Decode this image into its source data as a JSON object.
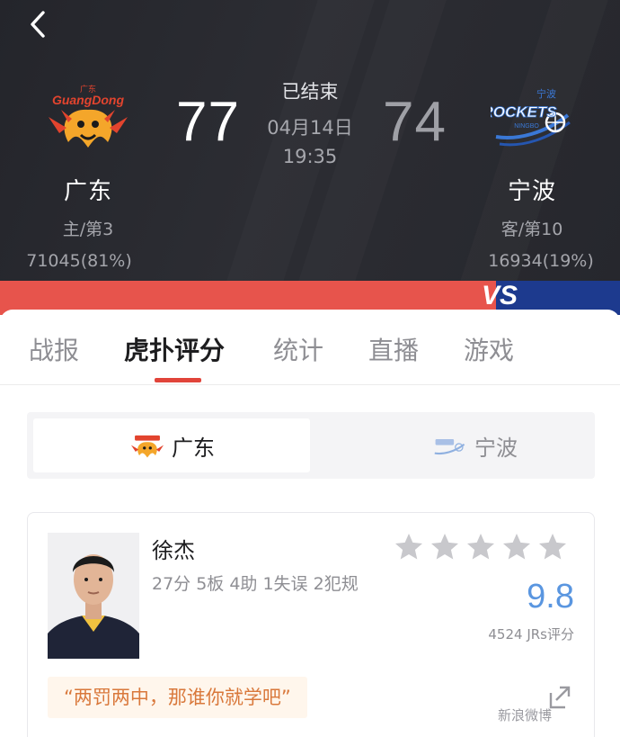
{
  "header": {
    "status": "已结束",
    "date": "04月14日",
    "time": "19:35",
    "home": {
      "name": "广东",
      "score": "77",
      "rank": "主/第3",
      "votes": "71045(81%)",
      "logo_text": "GuangDong",
      "logo_small": "广东"
    },
    "away": {
      "name": "宁波",
      "score": "74",
      "rank": "客/第10",
      "votes": "16934(19%)",
      "logo_text": "ROCKETS",
      "logo_small": "宁波",
      "logo_sub": "NINGBO"
    }
  },
  "vs_label": "VS",
  "tabs": [
    {
      "label": "战报"
    },
    {
      "label": "虎扑评分",
      "active": true
    },
    {
      "label": "统计"
    },
    {
      "label": "直播"
    },
    {
      "label": "游戏"
    }
  ],
  "segment": {
    "home_label": "广东",
    "away_label": "宁波"
  },
  "player": {
    "name": "徐杰",
    "stats": "27分 5板 4助 1失误 2犯规",
    "stars": 5,
    "rating": "9.8",
    "rating_count": "4524 JRs评分",
    "quote": "“两罚两中，那谁你就学吧”"
  },
  "watermark": "新浪微博",
  "colors": {
    "header_bg": "#2a2b31",
    "accent_red": "#e1443a",
    "vs_red": "#e7544c",
    "vs_blue": "#1d3a8e",
    "rating_blue": "#5a96e0",
    "quote_orange": "#d9783b",
    "star_gray": "#c8c8cc"
  }
}
